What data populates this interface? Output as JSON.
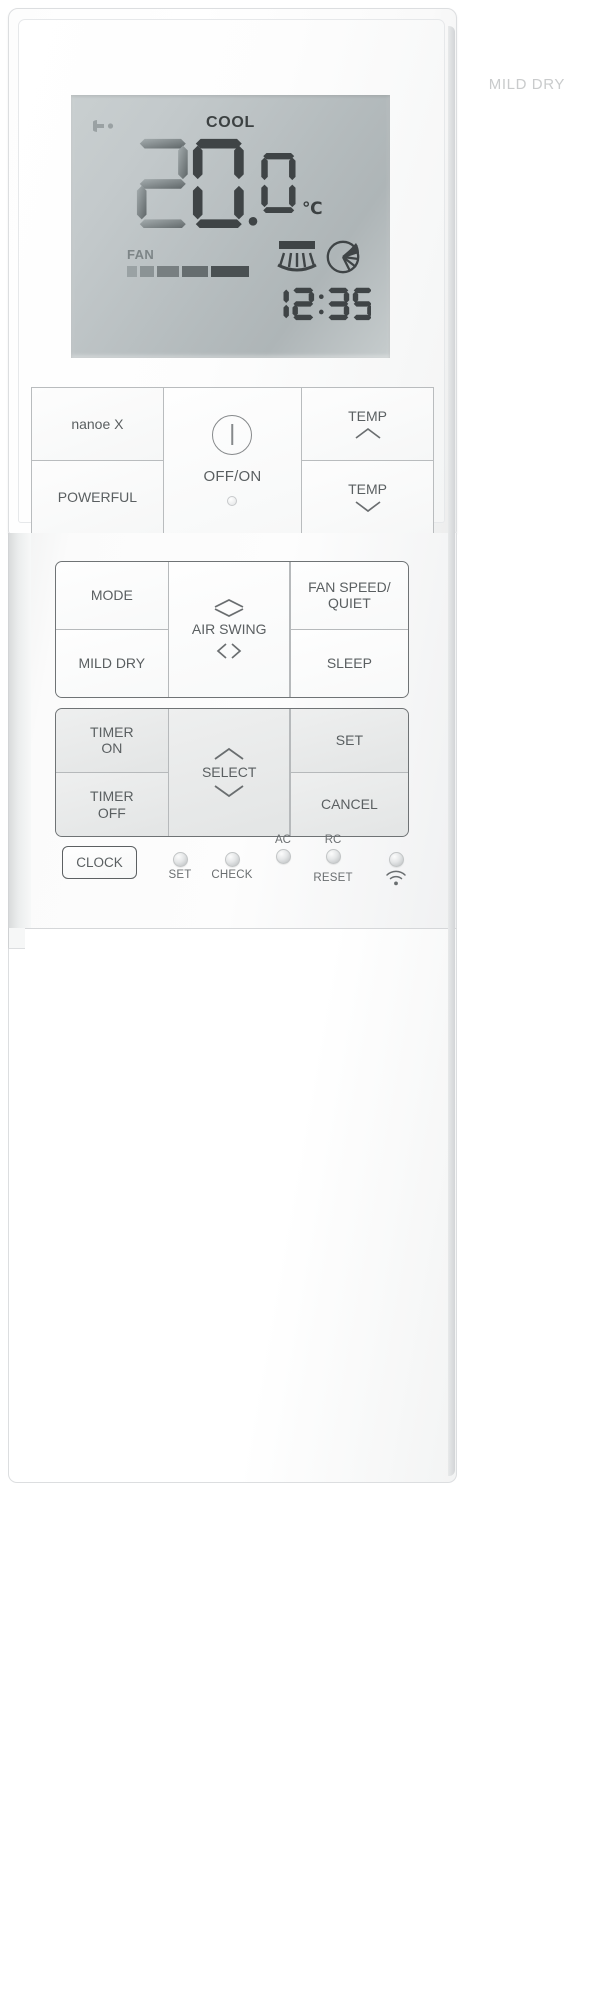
{
  "device": {
    "type": "air-conditioner-remote-control",
    "printed_label_top_right": "MILD DRY"
  },
  "lcd": {
    "mode_label": "COOL",
    "temperature": "20.0",
    "temperature_digits": [
      "2",
      "0",
      "0"
    ],
    "unit": "℃",
    "fan_label": "FAN",
    "fan_bar_segments": 5,
    "clock": "12:35",
    "clock_digits": [
      "1",
      "2",
      "3",
      "5"
    ],
    "icons": {
      "signal": "signal-icon",
      "vertical_swing": "vertical-air-swing-icon",
      "horizontal_swing": "horizontal-air-swing-icon"
    },
    "colors": {
      "lcd_background": "#b9c0c2",
      "segment_dark": "#3c4142",
      "segment_mid": "#5a6062",
      "segment_light": "#8e9698"
    }
  },
  "top_buttons": {
    "nanoe": "nanoe X",
    "powerful": "POWERFUL",
    "power": "OFF/ON",
    "temp_up": "TEMP",
    "temp_down": "TEMP",
    "temp_up_icon": "chevron-up-icon",
    "temp_down_icon": "chevron-down-icon",
    "power_icon": "power-symbol-icon",
    "power_led": "power-indicator-led"
  },
  "mode_block": {
    "mode": "MODE",
    "mild_dry": "MILD DRY",
    "air_swing": "AIR SWING",
    "air_swing_vertical_icon": "chevron-up-down-icon",
    "air_swing_horizontal_icon": "chevron-left-right-icon",
    "fan_speed_quiet_line1": "FAN SPEED/",
    "fan_speed_quiet_line2": "QUIET",
    "sleep": "SLEEP"
  },
  "timer_block": {
    "timer_on_line1": "TIMER",
    "timer_on_line2": "ON",
    "timer_off_line1": "TIMER",
    "timer_off_line2": "OFF",
    "select": "SELECT",
    "select_up_icon": "caret-up-icon",
    "select_down_icon": "caret-down-icon",
    "set": "SET",
    "cancel": "CANCEL"
  },
  "bottom_row": {
    "clock": "CLOCK",
    "set": "SET",
    "check": "CHECK",
    "ac": "AC",
    "rc": "RC",
    "reset": "RESET",
    "wifi_icon": "wifi-icon"
  }
}
